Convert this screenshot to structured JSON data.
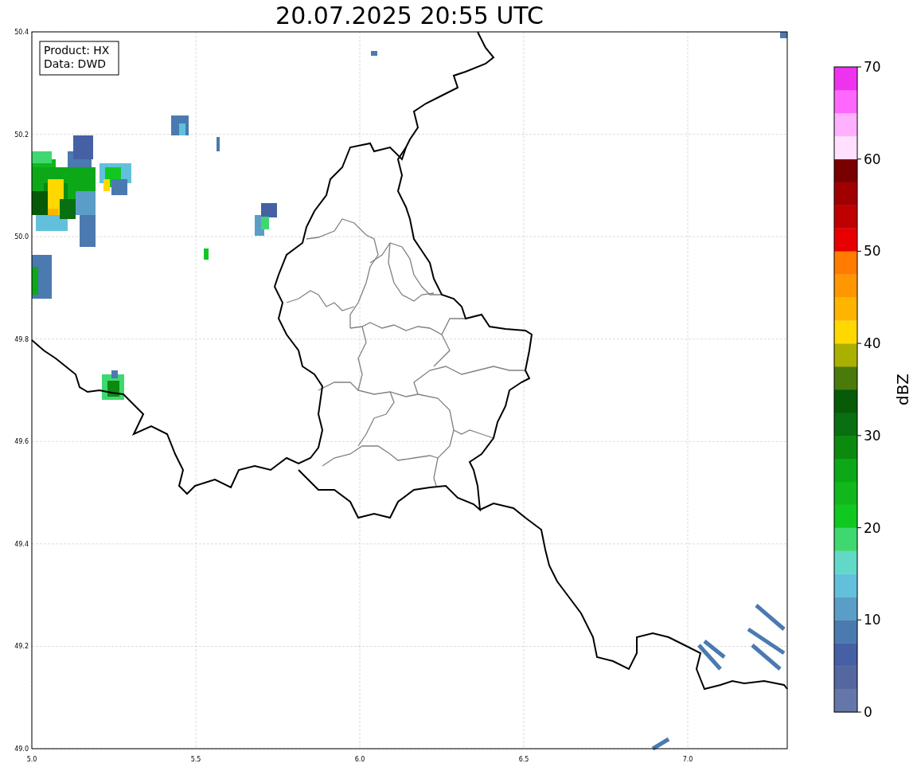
{
  "title": "20.07.2025 20:55 UTC",
  "legend": [
    "Product: HX",
    "Data: DWD"
  ],
  "map": {
    "xticks": [
      "5.0",
      "5.5",
      "6.0",
      "6.5",
      "7.0"
    ],
    "yticks": [
      "50.4",
      "50.2",
      "50.0",
      "49.8",
      "49.6",
      "49.4",
      "49.2",
      "49.0"
    ]
  },
  "colorbar": {
    "label": "dBZ",
    "ticks": [
      "70",
      "60",
      "50",
      "40",
      "30",
      "20",
      "10",
      "0"
    ],
    "segments": [
      {
        "color": "#6577a8"
      },
      {
        "color": "#5567a0"
      },
      {
        "color": "#4560a4"
      },
      {
        "color": "#4a7ab0"
      },
      {
        "color": "#5a9ec8"
      },
      {
        "color": "#62c0dc"
      },
      {
        "color": "#62d8c8"
      },
      {
        "color": "#3fd870"
      },
      {
        "color": "#10c820"
      },
      {
        "color": "#10b81c"
      },
      {
        "color": "#0ca818"
      },
      {
        "color": "#0c8a10"
      },
      {
        "color": "#087010"
      },
      {
        "color": "#065a08"
      },
      {
        "color": "#4a7a0a"
      },
      {
        "color": "#aab000"
      },
      {
        "color": "#ffd800"
      },
      {
        "color": "#ffb400"
      },
      {
        "color": "#ff9800"
      },
      {
        "color": "#ff7c00"
      },
      {
        "color": "#e80000"
      },
      {
        "color": "#c00000"
      },
      {
        "color": "#a00000"
      },
      {
        "color": "#7a0000"
      },
      {
        "color": "#ffe0ff"
      },
      {
        "color": "#ffb0ff"
      },
      {
        "color": "#ff68ff"
      },
      {
        "color": "#ee33ee"
      }
    ]
  }
}
